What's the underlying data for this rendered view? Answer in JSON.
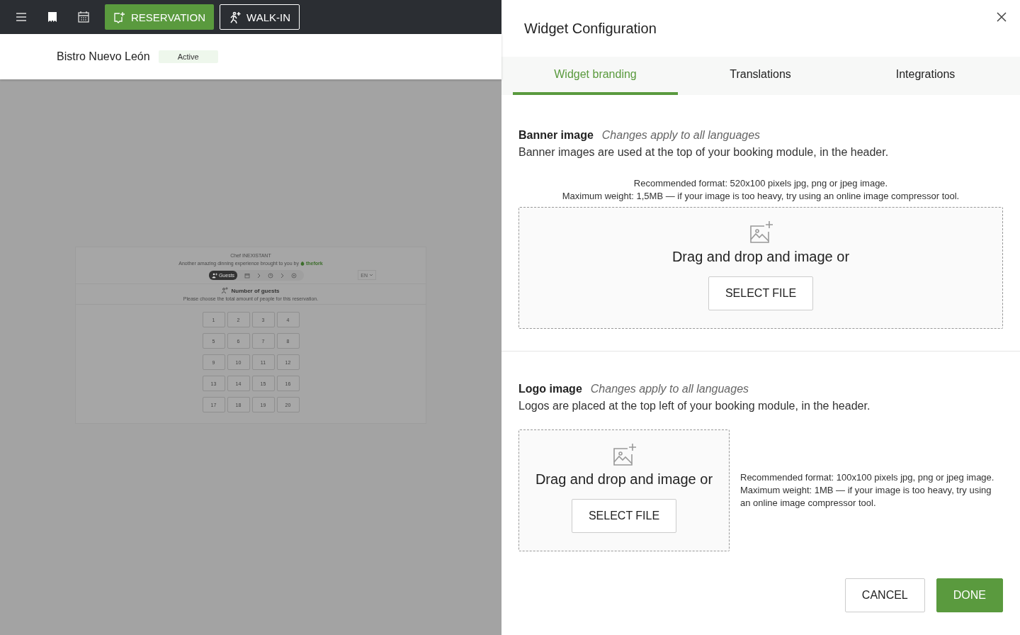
{
  "top_bar": {
    "buttons": [
      {
        "label": "RESERVATION",
        "kind": "primary"
      },
      {
        "label": "WALK-IN",
        "kind": "outline"
      }
    ]
  },
  "restaurant": {
    "name": "Bistro Nuevo León",
    "status": "Active"
  },
  "preview": {
    "title": "Chef INEXISTANT",
    "tagline": "Another amazing dinning experience brought to you by",
    "brand": "thefork",
    "steps": [
      {
        "kind": "guests",
        "label": "Guests",
        "selected": true
      },
      {
        "kind": "date",
        "selected": false
      },
      {
        "kind": "time",
        "selected": false
      },
      {
        "kind": "offer",
        "selected": false
      }
    ],
    "language": "EN",
    "heading": "Number of guests",
    "subtitle": "Please choose the total amount of people for this reservation.",
    "guests": [
      "1",
      "2",
      "3",
      "4",
      "5",
      "6",
      "7",
      "8",
      "9",
      "10",
      "11",
      "12",
      "13",
      "14",
      "15",
      "16",
      "17",
      "18",
      "19",
      "20"
    ]
  },
  "dialog": {
    "title": "Widget Configuration",
    "tabs": [
      {
        "label": "Widget branding",
        "selected": true
      },
      {
        "label": "Translations",
        "selected": false
      },
      {
        "label": "Integrations",
        "selected": false
      }
    ],
    "sections": [
      {
        "title": "Banner image",
        "note": "Changes apply to all languages",
        "description": "Banner images are used at the top of your booking module, in the header.",
        "kind": "wide",
        "requirements": [
          "Recommended format: 520x100 pixels jpg, png or jpeg image.",
          "Maximum weight: 1,5MB — if your image is too heavy, try using an online image compressor tool."
        ],
        "dropzone": {
          "text": "Drag and drop and image or",
          "button": "SELECT FILE"
        }
      },
      {
        "title": "Logo image",
        "note": "Changes apply to all languages",
        "description": "Logos are placed at the top left of your booking module, in the header.",
        "kind": "side",
        "requirements": [
          "Recommended format: 100x100 pixels jpg, png or jpeg image.",
          "Maximum weight: 1MB — if your image is too heavy, try using an online image compressor tool."
        ],
        "dropzone": {
          "text": "Drag and drop and image or",
          "button": "SELECT FILE"
        }
      }
    ],
    "buttons": [
      {
        "label": "CANCEL",
        "kind": "secondary"
      },
      {
        "label": "DONE",
        "kind": "primary"
      }
    ]
  }
}
